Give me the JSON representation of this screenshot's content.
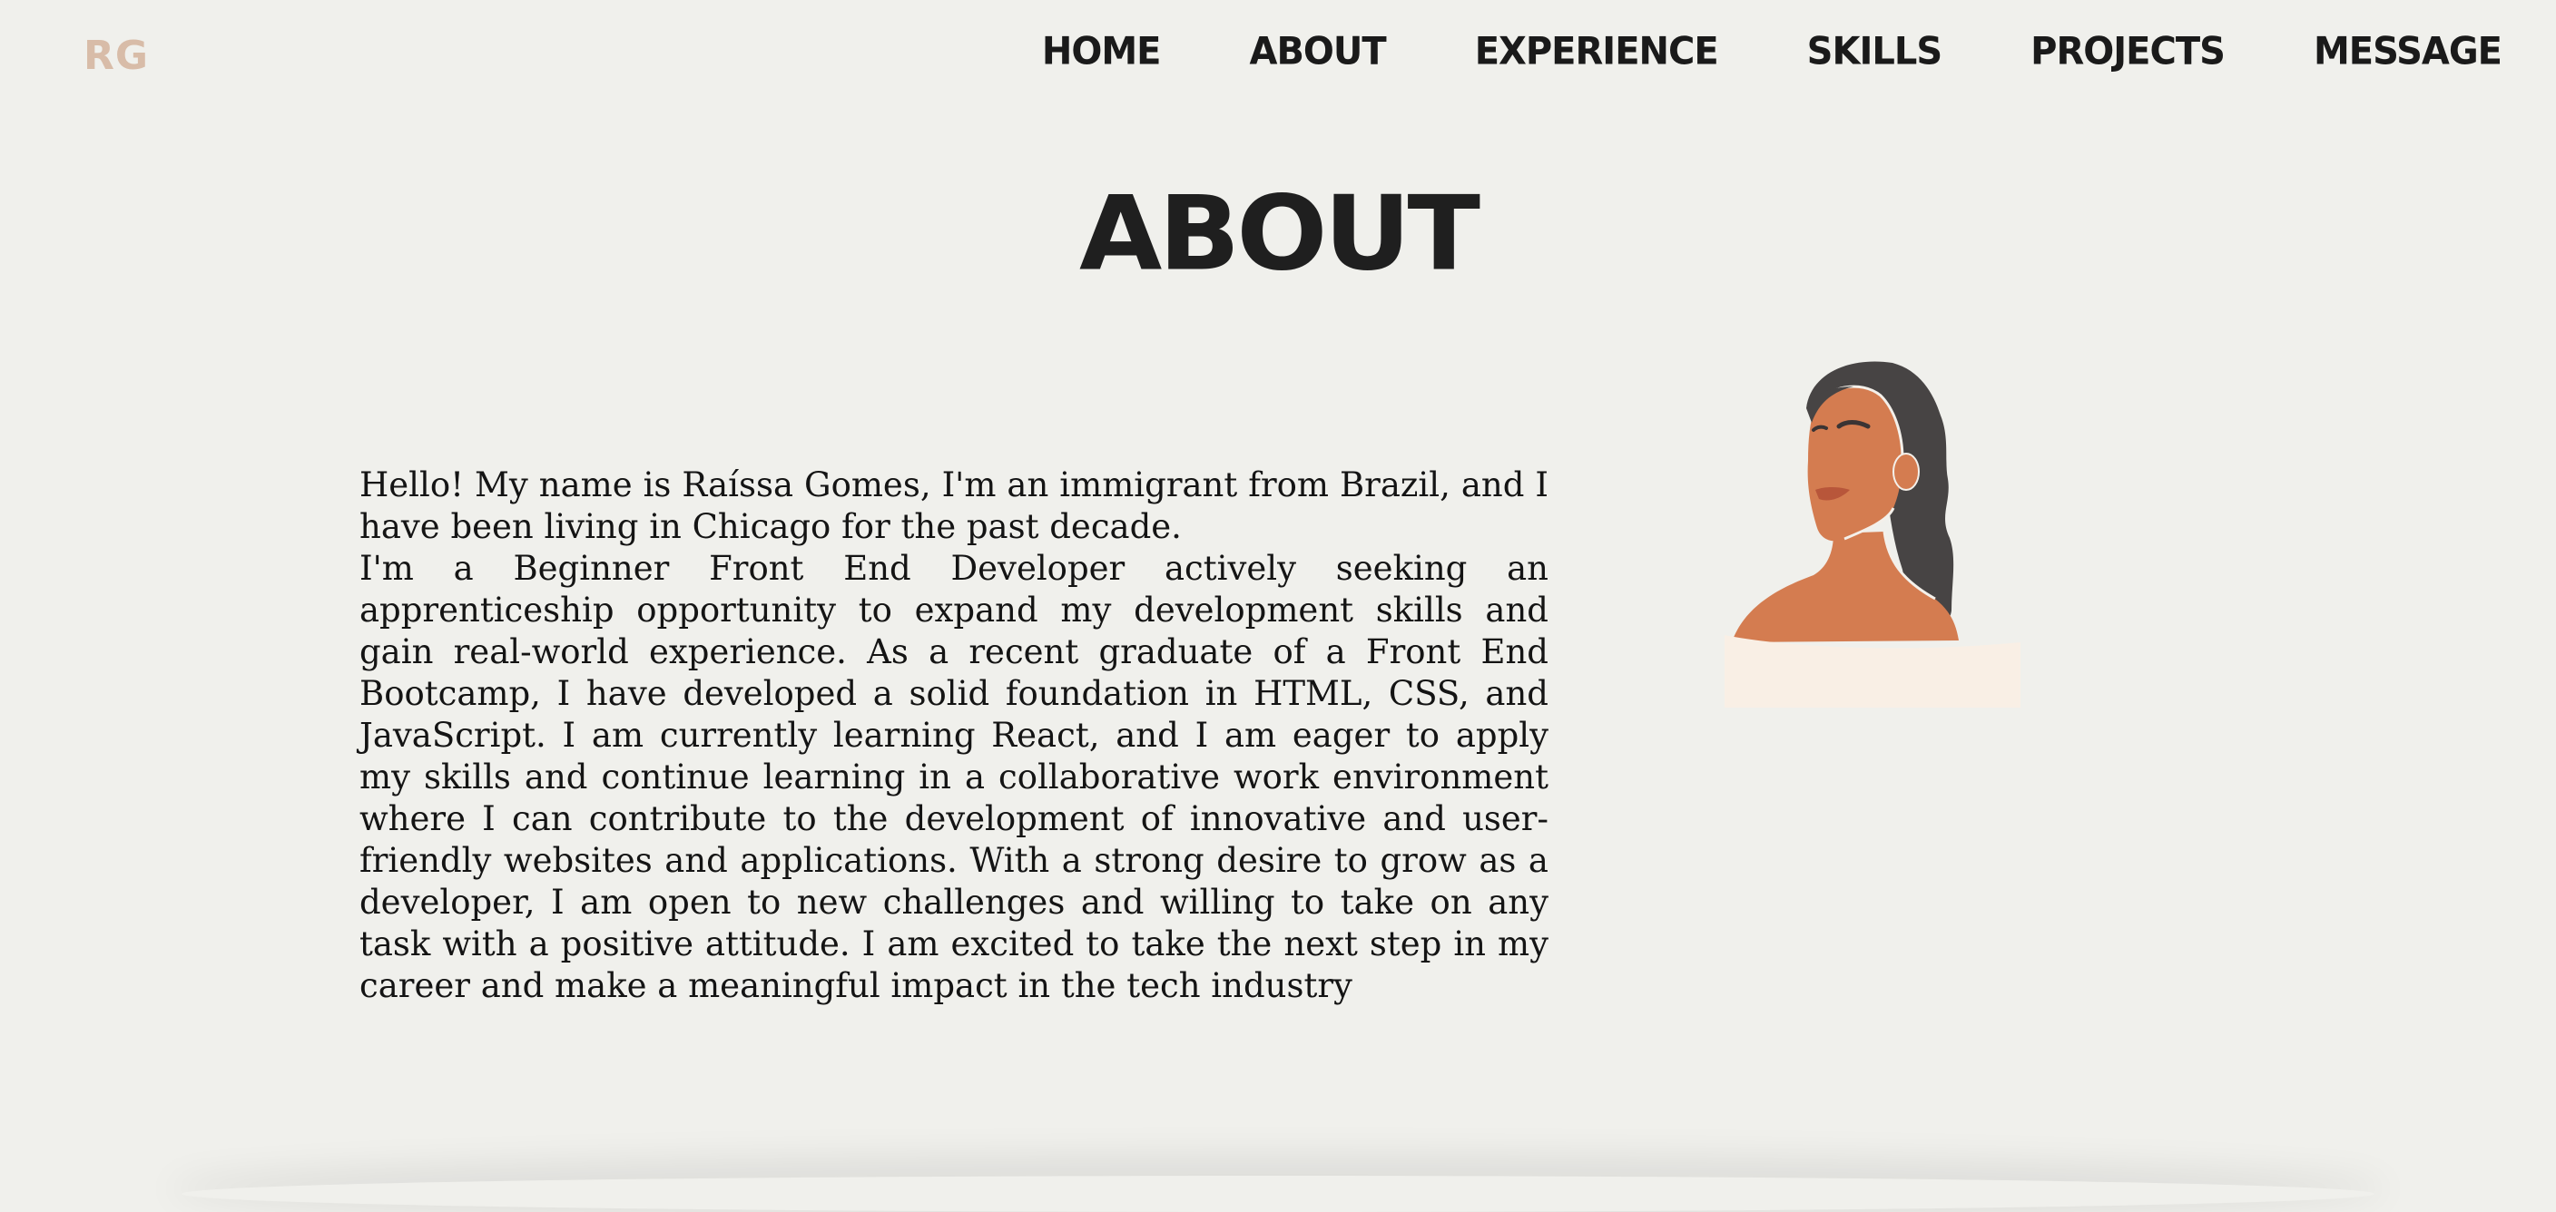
{
  "logo": {
    "text": "RG",
    "color": "#d8bca8"
  },
  "nav": {
    "items": [
      {
        "label": "Home"
      },
      {
        "label": "About"
      },
      {
        "label": "Experience"
      },
      {
        "label": "Skills"
      },
      {
        "label": "Projects"
      },
      {
        "label": "Message"
      }
    ]
  },
  "about": {
    "title": "ABOUT",
    "paragraphs": [
      "Hello! My name is Raíssa Gomes, I'm an immigrant from Brazil, and I have been living in Chicago for the past decade.",
      "I'm a Beginner Front End Developer actively seeking an apprenticeship opportunity to expand my development skills and gain real-world experience. As a recent graduate of a Front End Bootcamp, I have developed a solid foundation in HTML, CSS, and JavaScript. I am currently learning React, and I am eager to apply my skills and continue learning in a collaborative work environment where I can contribute to the development of innovative and user-friendly websites and applications. With a strong desire to grow as a developer, I am open to new challenges and willing to take on any task with a positive attitude. I am excited to take the next step in my career and make a meaningful impact in the tech industry"
    ],
    "avatar_icon": "woman-portrait-illustration"
  },
  "colors": {
    "background": "#f0f0ec",
    "text": "#1a1a1a",
    "logo": "#d8bca8",
    "skin": "#d47c50",
    "hair": "#474444",
    "garment": "#f9efe5"
  }
}
